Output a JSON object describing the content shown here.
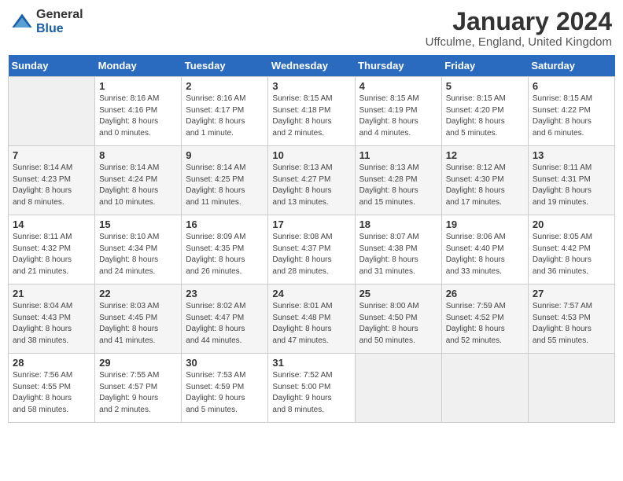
{
  "logo": {
    "general": "General",
    "blue": "Blue"
  },
  "title": "January 2024",
  "location": "Uffculme, England, United Kingdom",
  "days_of_week": [
    "Sunday",
    "Monday",
    "Tuesday",
    "Wednesday",
    "Thursday",
    "Friday",
    "Saturday"
  ],
  "weeks": [
    [
      {
        "day": "",
        "info": ""
      },
      {
        "day": "1",
        "info": "Sunrise: 8:16 AM\nSunset: 4:16 PM\nDaylight: 8 hours\nand 0 minutes."
      },
      {
        "day": "2",
        "info": "Sunrise: 8:16 AM\nSunset: 4:17 PM\nDaylight: 8 hours\nand 1 minute."
      },
      {
        "day": "3",
        "info": "Sunrise: 8:15 AM\nSunset: 4:18 PM\nDaylight: 8 hours\nand 2 minutes."
      },
      {
        "day": "4",
        "info": "Sunrise: 8:15 AM\nSunset: 4:19 PM\nDaylight: 8 hours\nand 4 minutes."
      },
      {
        "day": "5",
        "info": "Sunrise: 8:15 AM\nSunset: 4:20 PM\nDaylight: 8 hours\nand 5 minutes."
      },
      {
        "day": "6",
        "info": "Sunrise: 8:15 AM\nSunset: 4:22 PM\nDaylight: 8 hours\nand 6 minutes."
      }
    ],
    [
      {
        "day": "7",
        "info": "Sunrise: 8:14 AM\nSunset: 4:23 PM\nDaylight: 8 hours\nand 8 minutes."
      },
      {
        "day": "8",
        "info": "Sunrise: 8:14 AM\nSunset: 4:24 PM\nDaylight: 8 hours\nand 10 minutes."
      },
      {
        "day": "9",
        "info": "Sunrise: 8:14 AM\nSunset: 4:25 PM\nDaylight: 8 hours\nand 11 minutes."
      },
      {
        "day": "10",
        "info": "Sunrise: 8:13 AM\nSunset: 4:27 PM\nDaylight: 8 hours\nand 13 minutes."
      },
      {
        "day": "11",
        "info": "Sunrise: 8:13 AM\nSunset: 4:28 PM\nDaylight: 8 hours\nand 15 minutes."
      },
      {
        "day": "12",
        "info": "Sunrise: 8:12 AM\nSunset: 4:30 PM\nDaylight: 8 hours\nand 17 minutes."
      },
      {
        "day": "13",
        "info": "Sunrise: 8:11 AM\nSunset: 4:31 PM\nDaylight: 8 hours\nand 19 minutes."
      }
    ],
    [
      {
        "day": "14",
        "info": "Sunrise: 8:11 AM\nSunset: 4:32 PM\nDaylight: 8 hours\nand 21 minutes."
      },
      {
        "day": "15",
        "info": "Sunrise: 8:10 AM\nSunset: 4:34 PM\nDaylight: 8 hours\nand 24 minutes."
      },
      {
        "day": "16",
        "info": "Sunrise: 8:09 AM\nSunset: 4:35 PM\nDaylight: 8 hours\nand 26 minutes."
      },
      {
        "day": "17",
        "info": "Sunrise: 8:08 AM\nSunset: 4:37 PM\nDaylight: 8 hours\nand 28 minutes."
      },
      {
        "day": "18",
        "info": "Sunrise: 8:07 AM\nSunset: 4:38 PM\nDaylight: 8 hours\nand 31 minutes."
      },
      {
        "day": "19",
        "info": "Sunrise: 8:06 AM\nSunset: 4:40 PM\nDaylight: 8 hours\nand 33 minutes."
      },
      {
        "day": "20",
        "info": "Sunrise: 8:05 AM\nSunset: 4:42 PM\nDaylight: 8 hours\nand 36 minutes."
      }
    ],
    [
      {
        "day": "21",
        "info": "Sunrise: 8:04 AM\nSunset: 4:43 PM\nDaylight: 8 hours\nand 38 minutes."
      },
      {
        "day": "22",
        "info": "Sunrise: 8:03 AM\nSunset: 4:45 PM\nDaylight: 8 hours\nand 41 minutes."
      },
      {
        "day": "23",
        "info": "Sunrise: 8:02 AM\nSunset: 4:47 PM\nDaylight: 8 hours\nand 44 minutes."
      },
      {
        "day": "24",
        "info": "Sunrise: 8:01 AM\nSunset: 4:48 PM\nDaylight: 8 hours\nand 47 minutes."
      },
      {
        "day": "25",
        "info": "Sunrise: 8:00 AM\nSunset: 4:50 PM\nDaylight: 8 hours\nand 50 minutes."
      },
      {
        "day": "26",
        "info": "Sunrise: 7:59 AM\nSunset: 4:52 PM\nDaylight: 8 hours\nand 52 minutes."
      },
      {
        "day": "27",
        "info": "Sunrise: 7:57 AM\nSunset: 4:53 PM\nDaylight: 8 hours\nand 55 minutes."
      }
    ],
    [
      {
        "day": "28",
        "info": "Sunrise: 7:56 AM\nSunset: 4:55 PM\nDaylight: 8 hours\nand 58 minutes."
      },
      {
        "day": "29",
        "info": "Sunrise: 7:55 AM\nSunset: 4:57 PM\nDaylight: 9 hours\nand 2 minutes."
      },
      {
        "day": "30",
        "info": "Sunrise: 7:53 AM\nSunset: 4:59 PM\nDaylight: 9 hours\nand 5 minutes."
      },
      {
        "day": "31",
        "info": "Sunrise: 7:52 AM\nSunset: 5:00 PM\nDaylight: 9 hours\nand 8 minutes."
      },
      {
        "day": "",
        "info": ""
      },
      {
        "day": "",
        "info": ""
      },
      {
        "day": "",
        "info": ""
      }
    ]
  ]
}
